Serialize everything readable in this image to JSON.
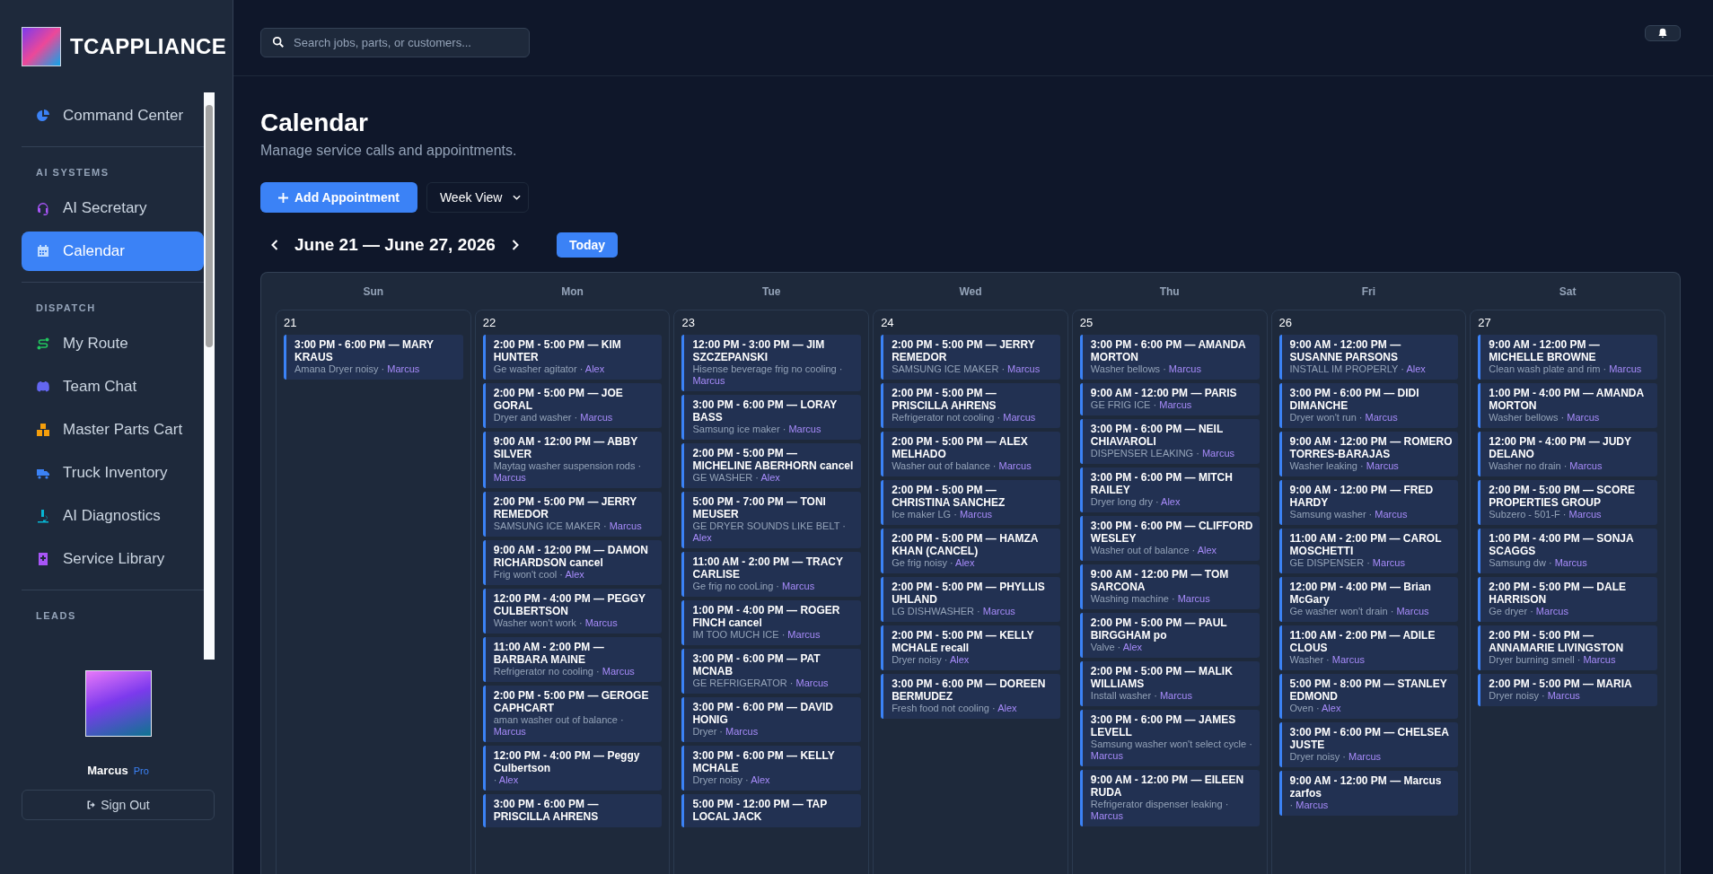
{
  "brand": {
    "name": "TCAPPLIANCE"
  },
  "sidebar": {
    "items": [
      {
        "kind": "item",
        "label": "Command Center",
        "selected": false
      },
      {
        "kind": "section",
        "label": "AI SYSTEMS"
      },
      {
        "kind": "item",
        "label": "AI Secretary",
        "selected": false
      },
      {
        "kind": "item",
        "label": "Calendar",
        "selected": true
      },
      {
        "kind": "section",
        "label": "DISPATCH"
      },
      {
        "kind": "item",
        "label": "My Route",
        "selected": false
      },
      {
        "kind": "item",
        "label": "Team Chat",
        "selected": false
      },
      {
        "kind": "item",
        "label": "Master Parts Cart",
        "selected": false
      },
      {
        "kind": "item",
        "label": "Truck Inventory",
        "selected": false
      },
      {
        "kind": "item",
        "label": "AI Diagnostics",
        "selected": false
      },
      {
        "kind": "item",
        "label": "Service Library",
        "selected": false
      },
      {
        "kind": "section",
        "label": "LEADS"
      }
    ],
    "user": {
      "name": "Marcus",
      "plan": "Pro"
    },
    "sign_out": "Sign Out"
  },
  "search": {
    "placeholder": "Search jobs, parts, or customers..."
  },
  "page": {
    "title": "Calendar",
    "subtitle": "Manage service calls and appointments.",
    "add_button": "Add Appointment",
    "view": "Week View",
    "range": "June 21 — June 27, 2026",
    "today": "Today"
  },
  "days": [
    {
      "weekday": "Sun",
      "date": "21",
      "events": [
        {
          "title": "3:00 PM - 6:00 PM — MARY KRAUS",
          "description": "Amana Dryer noisy ·",
          "tech": "Marcus"
        }
      ]
    },
    {
      "weekday": "Mon",
      "date": "22",
      "events": [
        {
          "title": "2:00 PM - 5:00 PM — KIM HUNTER",
          "description": "Ge washer agitator ·",
          "tech": "Alex"
        },
        {
          "title": "2:00 PM - 5:00 PM — JOE GORAL",
          "description": "Dryer and washer ·",
          "tech": "Marcus"
        },
        {
          "title": "9:00 AM - 12:00 PM — ABBY SILVER",
          "description": "Maytag washer suspension rods ·",
          "tech": "Marcus"
        },
        {
          "title": "2:00 PM - 5:00 PM — JERRY REMEDOR",
          "description": "SAMSUNG ICE MAKER ·",
          "tech": "Marcus"
        },
        {
          "title": "9:00 AM - 12:00 PM — DAMON RICHARDSON cancel",
          "description": "Frig won't cool ·",
          "tech": "Alex"
        },
        {
          "title": "12:00 PM - 4:00 PM — PEGGY CULBERTSON",
          "description": "Washer won't work ·",
          "tech": "Marcus"
        },
        {
          "title": "11:00 AM - 2:00 PM — BARBARA MAINE",
          "description": "Refrigerator no cooling ·",
          "tech": "Marcus"
        },
        {
          "title": "2:00 PM - 5:00 PM — GEROGE CAPHCART",
          "description": "aman washer out of balance ·",
          "tech": "Marcus"
        },
        {
          "title": "12:00 PM - 4:00 PM — Peggy Culbertson",
          "description": "·",
          "tech": "Alex"
        },
        {
          "title": "3:00 PM - 6:00 PM — PRISCILLA AHRENS"
        }
      ]
    },
    {
      "weekday": "Tue",
      "date": "23",
      "events": [
        {
          "title": "12:00 PM - 3:00 PM — JIM SZCZEPANSKI",
          "description": "Hisense beverage frig no cooling ·",
          "tech": "Marcus"
        },
        {
          "title": "3:00 PM - 6:00 PM — LORAY BASS",
          "description": "Samsung ice maker ·",
          "tech": "Marcus"
        },
        {
          "title": "2:00 PM - 5:00 PM — MICHELINE ABERHORN cancel",
          "description": "GE WASHER ·",
          "tech": "Alex"
        },
        {
          "title": "5:00 PM - 7:00 PM — TONI MEUSER",
          "description": "GE DRYER SOUNDS LIKE BELT ·",
          "tech": "Alex"
        },
        {
          "title": "11:00 AM - 2:00 PM — TRACY CARLISE",
          "description": "Ge frig no cooLing ·",
          "tech": "Marcus"
        },
        {
          "title": "1:00 PM - 4:00 PM — ROGER FINCH cancel",
          "description": "IM TOO MUCH ICE ·",
          "tech": "Marcus"
        },
        {
          "title": "3:00 PM - 6:00 PM — PAT MCNAB",
          "description": "GE REFRIGERATOR ·",
          "tech": "Marcus"
        },
        {
          "title": "3:00 PM - 6:00 PM — DAVID HONIG",
          "description": "Dryer ·",
          "tech": "Marcus"
        },
        {
          "title": "3:00 PM - 6:00 PM — KELLY MCHALE",
          "description": "Dryer noisy ·",
          "tech": "Alex"
        },
        {
          "title": "5:00 PM - 12:00 PM — TAP LOCAL JACK"
        }
      ]
    },
    {
      "weekday": "Wed",
      "date": "24",
      "events": [
        {
          "title": "2:00 PM - 5:00 PM — JERRY REMEDOR",
          "description": "SAMSUNG ICE MAKER ·",
          "tech": "Marcus"
        },
        {
          "title": "2:00 PM - 5:00 PM — PRISCILLA AHRENS",
          "description": "Refrigerator not cooling ·",
          "tech": "Marcus"
        },
        {
          "title": "2:00 PM - 5:00 PM — ALEX MELHADO",
          "description": "Washer out of balance ·",
          "tech": "Marcus"
        },
        {
          "title": "2:00 PM - 5:00 PM — CHRISTINA SANCHEZ",
          "description": "Ice maker LG ·",
          "tech": "Marcus"
        },
        {
          "title": "2:00 PM - 5:00 PM — HAMZA KHAN (CANCEL)",
          "description": "Ge frig noisy ·",
          "tech": "Alex"
        },
        {
          "title": "2:00 PM - 5:00 PM — PHYLLIS UHLAND",
          "description": "LG DISHWASHER ·",
          "tech": "Marcus"
        },
        {
          "title": "2:00 PM - 5:00 PM — KELLY MCHALE recall",
          "description": "Dryer noisy ·",
          "tech": "Alex"
        },
        {
          "title": "3:00 PM - 6:00 PM — DOREEN BERMUDEZ",
          "description": "Fresh food not cooling ·",
          "tech": "Alex"
        }
      ]
    },
    {
      "weekday": "Thu",
      "date": "25",
      "events": [
        {
          "title": "3:00 PM - 6:00 PM — AMANDA MORTON",
          "description": "Washer bellows ·",
          "tech": "Marcus"
        },
        {
          "title": "9:00 AM - 12:00 PM — PARIS",
          "description": "GE FRIG ICE ·",
          "tech": "Marcus"
        },
        {
          "title": "3:00 PM - 6:00 PM — NEIL CHIAVAROLI",
          "description": "DISPENSER LEAKING ·",
          "tech": "Marcus"
        },
        {
          "title": "3:00 PM - 6:00 PM — MITCH RAILEY",
          "description": "Dryer long dry ·",
          "tech": "Alex"
        },
        {
          "title": "3:00 PM - 6:00 PM — CLIFFORD WESLEY",
          "description": "Washer out of balance ·",
          "tech": "Alex"
        },
        {
          "title": "9:00 AM - 12:00 PM — TOM SARCONA",
          "description": "Washing machine ·",
          "tech": "Marcus"
        },
        {
          "title": "2:00 PM - 5:00 PM — PAUL BIRGGHAM po",
          "description": "Valve ·",
          "tech": "Alex"
        },
        {
          "title": "2:00 PM - 5:00 PM — MALIK WILLIAMS",
          "description": "Install washer ·",
          "tech": "Marcus"
        },
        {
          "title": "3:00 PM - 6:00 PM — JAMES LEVELL",
          "description": "Samsung washer won't select cycle ·",
          "tech": "Marcus"
        },
        {
          "title": "9:00 AM - 12:00 PM — EILEEN RUDA",
          "description": "Refrigerator dispenser leaking ·",
          "tech": "Marcus"
        }
      ]
    },
    {
      "weekday": "Fri",
      "date": "26",
      "events": [
        {
          "title": "9:00 AM - 12:00 PM — SUSANNE PARSONS",
          "description": "INSTALL IM PROPERLY ·",
          "tech": "Alex"
        },
        {
          "title": "3:00 PM - 6:00 PM — DIDI DIMANCHE",
          "description": "Dryer won't run ·",
          "tech": "Marcus"
        },
        {
          "title": "9:00 AM - 12:00 PM — ROMERO TORRES-BARAJAS",
          "description": "Washer leaking ·",
          "tech": "Marcus"
        },
        {
          "title": "9:00 AM - 12:00 PM — FRED HARDY",
          "description": "Samsung washer ·",
          "tech": "Marcus"
        },
        {
          "title": "11:00 AM - 2:00 PM — CAROL MOSCHETTI",
          "description": "GE DISPENSER ·",
          "tech": "Marcus"
        },
        {
          "title": "12:00 PM - 4:00 PM — Brian McGary",
          "description": "Ge washer won't drain ·",
          "tech": "Marcus"
        },
        {
          "title": "11:00 AM - 2:00 PM — ADILE CLOUS",
          "description": "Washer ·",
          "tech": "Marcus"
        },
        {
          "title": "5:00 PM - 8:00 PM — STANLEY EDMOND",
          "description": "Oven ·",
          "tech": "Alex"
        },
        {
          "title": "3:00 PM - 6:00 PM — CHELSEA JUSTE",
          "description": "Dryer noisy ·",
          "tech": "Marcus"
        },
        {
          "title": "9:00 AM - 12:00 PM — Marcus zarfos",
          "description": "·",
          "tech": "Marcus"
        }
      ]
    },
    {
      "weekday": "Sat",
      "date": "27",
      "events": [
        {
          "title": "9:00 AM - 12:00 PM — MICHELLE BROWNE",
          "description": "Clean wash plate and rim ·",
          "tech": "Marcus"
        },
        {
          "title": "1:00 PM - 4:00 PM — AMANDA MORTON",
          "description": "Washer bellows ·",
          "tech": "Marcus"
        },
        {
          "title": "12:00 PM - 4:00 PM — JUDY DELANO",
          "description": "Washer no drain ·",
          "tech": "Marcus"
        },
        {
          "title": "2:00 PM - 5:00 PM — SCORE PROPERTIES GROUP",
          "description": "Subzero - 501-F ·",
          "tech": "Marcus"
        },
        {
          "title": "1:00 PM - 4:00 PM — SONJA SCAGGS",
          "description": "Samsung dw ·",
          "tech": "Marcus"
        },
        {
          "title": "2:00 PM - 5:00 PM — DALE HARRISON",
          "description": "Ge dryer ·",
          "tech": "Marcus"
        },
        {
          "title": "2:00 PM - 5:00 PM — ANNAMARIE LIVINGSTON",
          "description": "Dryer burning smell ·",
          "tech": "Marcus"
        },
        {
          "title": "2:00 PM - 5:00 PM — MARIA",
          "description": "Dryer noisy ·",
          "tech": "Marcus"
        }
      ]
    }
  ]
}
